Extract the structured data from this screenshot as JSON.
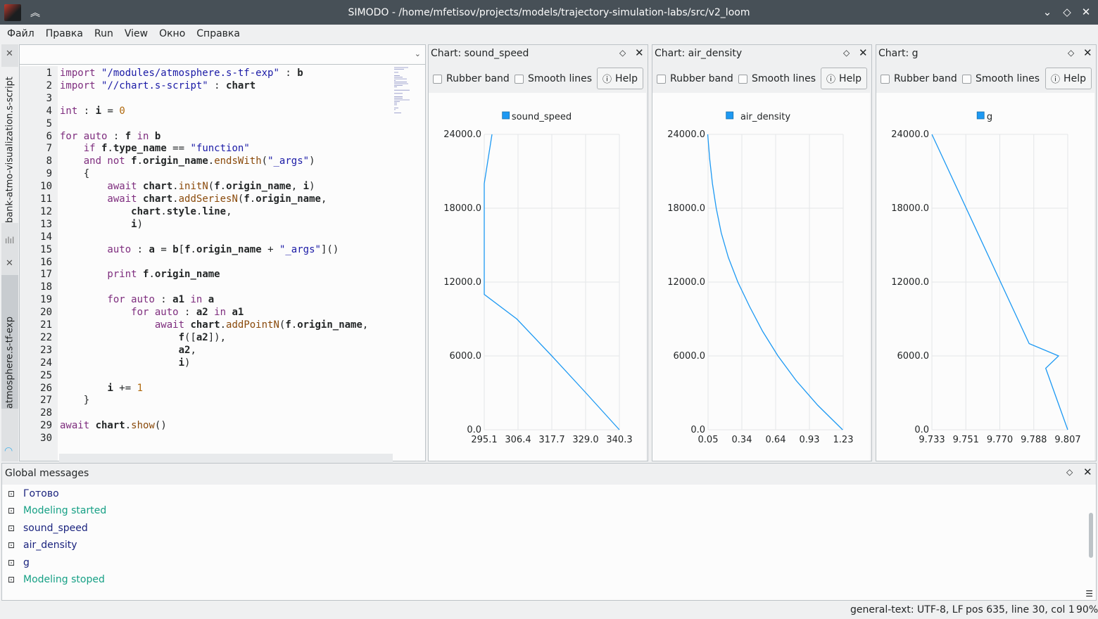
{
  "window": {
    "title": "SIMODO - /home/mfetisov/projects/models/trajectory-simulation-labs/src/v2_loom",
    "icons": {
      "app": "simodo-logo-icon",
      "keep_above": "keep-above-icon",
      "minimize": "minimize-icon",
      "maximize": "maximize-icon",
      "close": "close-icon"
    }
  },
  "menu": [
    "Файл",
    "Правка",
    "Run",
    "View",
    "Окно",
    "Справка"
  ],
  "side_tabs": {
    "top": "bank-atmo-visualization.s-script",
    "bottom": "atmosphere.s-tf-exp"
  },
  "editor": {
    "current_line": 30,
    "lines": [
      {
        "n": "1"
      },
      {
        "n": "2"
      },
      {
        "n": "3"
      },
      {
        "n": "4"
      },
      {
        "n": "5"
      },
      {
        "n": "6"
      },
      {
        "n": "7"
      },
      {
        "n": "8"
      },
      {
        "n": "9"
      },
      {
        "n": "10"
      },
      {
        "n": "11"
      },
      {
        "n": "12"
      },
      {
        "n": "13"
      },
      {
        "n": "14"
      },
      {
        "n": "15"
      },
      {
        "n": "16"
      },
      {
        "n": "17"
      },
      {
        "n": "18"
      },
      {
        "n": "19"
      },
      {
        "n": "20"
      },
      {
        "n": "21"
      },
      {
        "n": "22"
      },
      {
        "n": "23"
      },
      {
        "n": "24"
      },
      {
        "n": "25"
      },
      {
        "n": "26"
      },
      {
        "n": "27"
      },
      {
        "n": "28"
      },
      {
        "n": "29"
      },
      {
        "n": "30"
      }
    ],
    "code": {
      "l1": [
        "import ",
        "\"/modules/atmosphere.s-tf-exp\"",
        " : ",
        "b"
      ],
      "l2": [
        "import ",
        "\"//chart.s-script\"",
        " : ",
        "chart"
      ],
      "l4": [
        "int",
        " : ",
        "i",
        " = ",
        "0"
      ],
      "l6": [
        "for ",
        "auto",
        " : ",
        "f",
        " in ",
        "b"
      ],
      "l7": [
        "    if ",
        "f",
        ".",
        "type_name",
        " == ",
        "\"function\""
      ],
      "l8": [
        "    and not ",
        "f",
        ".",
        "origin_name",
        ".",
        "endsWith",
        "(",
        "\"_args\"",
        ")"
      ],
      "l9": [
        "    {"
      ],
      "l10": [
        "        await ",
        "chart",
        ".",
        "initN",
        "(",
        "f",
        ".",
        "origin_name",
        ", ",
        "i",
        ")"
      ],
      "l11": [
        "        await ",
        "chart",
        ".",
        "addSeriesN",
        "(",
        "f",
        ".",
        "origin_name",
        ","
      ],
      "l12": [
        "            ",
        "chart",
        ".",
        "style",
        ".",
        "line",
        ","
      ],
      "l13": [
        "            ",
        "i",
        ")"
      ],
      "l15": [
        "        auto",
        " : ",
        "a",
        " = ",
        "b",
        "[",
        "f",
        ".",
        "origin_name",
        " + ",
        "\"_args\"",
        "]()"
      ],
      "l17": [
        "        print ",
        "f",
        ".",
        "origin_name"
      ],
      "l19": [
        "        for ",
        "auto",
        " : ",
        "a1",
        " in ",
        "a"
      ],
      "l20": [
        "            for ",
        "auto",
        " : ",
        "a2",
        " in ",
        "a1"
      ],
      "l21": [
        "                await ",
        "chart",
        ".",
        "addPointN",
        "(",
        "f",
        ".",
        "origin_name",
        ","
      ],
      "l22": [
        "                    ",
        "f",
        "([",
        "a2",
        "]),"
      ],
      "l23": [
        "                    ",
        "a2",
        ","
      ],
      "l24": [
        "                    ",
        "i",
        ")"
      ],
      "l26": [
        "        ",
        "i",
        " += ",
        "1"
      ],
      "l27": [
        "    }"
      ],
      "l29": [
        "await ",
        "chart",
        ".",
        "show",
        "()"
      ]
    }
  },
  "charts_ui": {
    "rubber_band": "Rubber band",
    "smooth_lines": "Smooth lines",
    "help": "Help",
    "help_icon": "info-circle-icon",
    "float_icon": "float-diamond-icon",
    "close_icon": "close-icon",
    "series_color": "#1d99f3"
  },
  "chart_data": [
    {
      "type": "line",
      "title": "Chart: sound_speed",
      "legend": "sound_speed",
      "legend_placement": "top-center",
      "grid": true,
      "x_ticks": [
        "295.1",
        "306.4",
        "317.7",
        "329.0",
        "340.3"
      ],
      "y_ticks": [
        "0.0",
        "6000.0",
        "12000.0",
        "18000.0",
        "24000.0"
      ],
      "xlim": [
        295.1,
        340.3
      ],
      "ylim": [
        0,
        24000
      ],
      "series": [
        {
          "x": [
            340.3,
            329.1,
            317.7,
            306.0,
            295.1,
            295.1,
            295.1,
            297.7
          ],
          "y": [
            0,
            3000,
            6000,
            9000,
            11000,
            15000,
            20000,
            24000
          ]
        }
      ]
    },
    {
      "type": "line",
      "title": "Chart: air_density",
      "legend": "air_density",
      "legend_placement": "top-center",
      "grid": true,
      "x_ticks": [
        "0.05",
        "0.34",
        "0.64",
        "0.93",
        "1.23"
      ],
      "y_ticks": [
        "0.0",
        "6000.0",
        "12000.0",
        "18000.0",
        "24000.0"
      ],
      "xlim": [
        0.05,
        1.23
      ],
      "ylim": [
        0,
        24000
      ],
      "series": [
        {
          "x": [
            1.225,
            1.007,
            0.819,
            0.66,
            0.526,
            0.413,
            0.31,
            0.227,
            0.165,
            0.121,
            0.088,
            0.064,
            0.047
          ],
          "y": [
            0,
            2000,
            4000,
            6000,
            8000,
            10000,
            12000,
            14000,
            16000,
            18000,
            20000,
            22000,
            24000
          ]
        }
      ]
    },
    {
      "type": "line",
      "title": "Chart: g",
      "legend": "g",
      "legend_placement": "top-center",
      "grid": true,
      "x_ticks": [
        "9.733",
        "9.751",
        "9.770",
        "9.788",
        "9.807"
      ],
      "y_ticks": [
        "0.0",
        "6000.0",
        "12000.0",
        "18000.0",
        "24000.0"
      ],
      "xlim": [
        9.733,
        9.807
      ],
      "ylim": [
        0,
        24000
      ],
      "series": [
        {
          "x": [
            9.807,
            9.795,
            9.802,
            9.786,
            9.733
          ],
          "y": [
            0,
            5000,
            6000,
            7000,
            24000
          ]
        }
      ]
    }
  ],
  "messages": {
    "title": "Global messages",
    "items": [
      {
        "text": "Готово",
        "color": "#1a237e"
      },
      {
        "text": "Modeling started",
        "color": "#16a085"
      },
      {
        "text": "sound_speed",
        "color": "#1a237e"
      },
      {
        "text": "air_density",
        "color": "#1a237e"
      },
      {
        "text": "g",
        "color": "#1a237e"
      },
      {
        "text": "Modeling stoped",
        "color": "#16a085"
      }
    ]
  },
  "status": {
    "encoding": "general-text: UTF-8, LF",
    "position": "pos 635, line 30, col 1",
    "zoom": "90%"
  }
}
